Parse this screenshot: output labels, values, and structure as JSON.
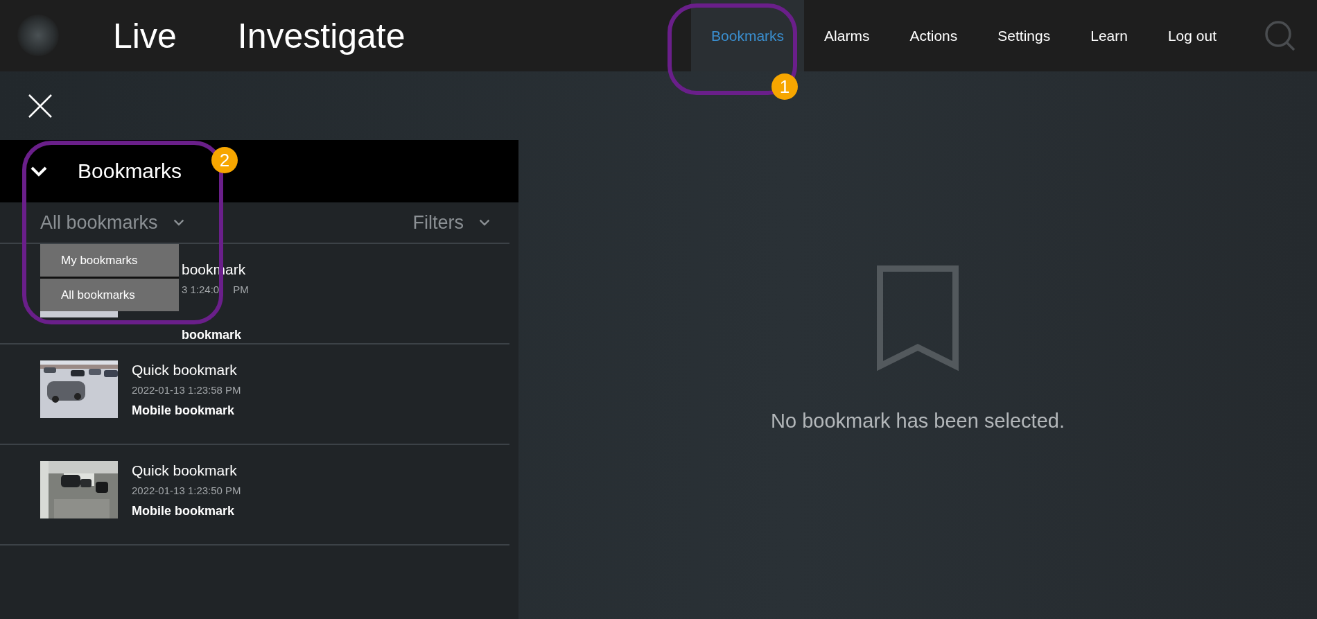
{
  "header": {
    "primary_nav": [
      {
        "label": "Live",
        "selected": false
      },
      {
        "label": "Investigate",
        "selected": false
      }
    ],
    "secondary_nav": [
      {
        "label": "Bookmarks",
        "selected": true
      },
      {
        "label": "Alarms",
        "selected": false
      },
      {
        "label": "Actions",
        "selected": false
      },
      {
        "label": "Settings",
        "selected": false
      },
      {
        "label": "Learn",
        "selected": false
      },
      {
        "label": "Log out",
        "selected": false
      }
    ]
  },
  "panel": {
    "title": "Bookmarks",
    "expanded": true,
    "scope_dropdown": {
      "value": "All bookmarks",
      "open": true,
      "options": [
        "My bookmarks",
        "All bookmarks"
      ]
    },
    "filters": "Filters",
    "items": [
      {
        "kind": "partial",
        "title": "bookmark",
        "time": "3 1:24:0",
        "time_end": "PM",
        "subtitle": "bookmark"
      },
      {
        "kind": "full",
        "title": "Quick bookmark",
        "time": "2022-01-13 1:23:58 PM",
        "subtitle": "Mobile bookmark"
      },
      {
        "kind": "full",
        "title": "Quick bookmark",
        "time": "2022-01-13 1:23:50 PM",
        "subtitle": "Mobile bookmark"
      }
    ]
  },
  "detail": {
    "empty_message": "No bookmark has been selected."
  },
  "callouts": [
    {
      "number": "1"
    },
    {
      "number": "2"
    }
  ]
}
